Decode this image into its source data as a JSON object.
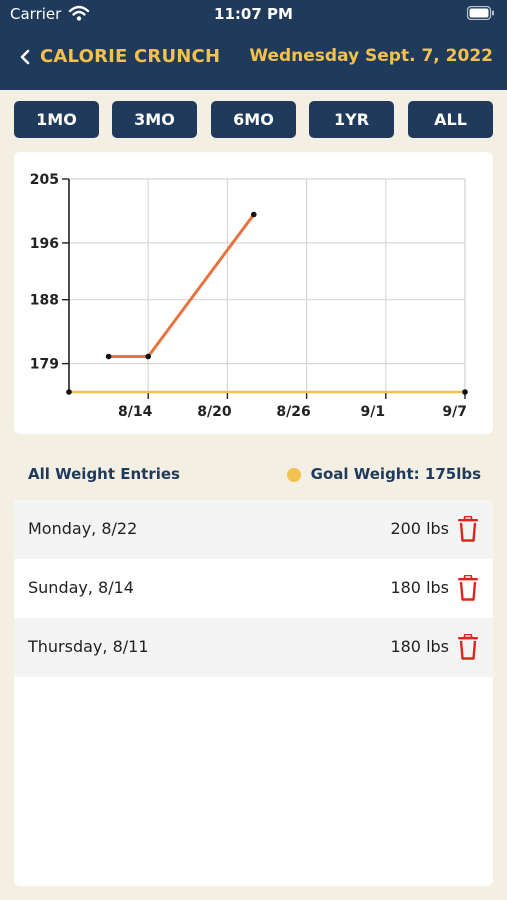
{
  "status_bar": {
    "carrier": "Carrier",
    "time": "11:07 PM"
  },
  "header": {
    "title": "CALORIE CRUNCH",
    "date": "Wednesday Sept. 7, 2022"
  },
  "range_buttons": [
    "1MO",
    "3MO",
    "6MO",
    "1YR",
    "ALL"
  ],
  "chart_data": {
    "type": "line",
    "x_ticks": [
      "8/14",
      "8/20",
      "8/26",
      "9/1",
      "9/7"
    ],
    "y_ticks": [
      "179",
      "188",
      "196",
      "205"
    ],
    "ylim": [
      175,
      205
    ],
    "series": [
      {
        "values": [
          {
            "x": "8/11",
            "y": 180
          },
          {
            "x": "8/14",
            "y": 180
          },
          {
            "x": "8/22",
            "y": 200
          }
        ]
      },
      {
        "values": [
          {
            "x": "8/8",
            "y": 175
          },
          {
            "x": "9/7",
            "y": 175
          }
        ]
      }
    ],
    "grid": true
  },
  "entries": {
    "title": "All Weight Entries",
    "goal_label": "Goal Weight: 175lbs",
    "rows": [
      {
        "day": "Monday, 8/22",
        "weight": "200 lbs"
      },
      {
        "day": "Sunday, 8/14",
        "weight": "180 lbs"
      },
      {
        "day": "Thursday, 8/11",
        "weight": "180 lbs"
      }
    ]
  },
  "colors": {
    "navy": "#1f3a5a",
    "gold": "#f2c14e",
    "weight_line": "#e8733f",
    "goal_line": "#f2c14e",
    "delete": "#e0231b"
  },
  "icons": [
    "wifi-icon",
    "battery-icon",
    "back-chevron-icon",
    "trash-icon"
  ]
}
